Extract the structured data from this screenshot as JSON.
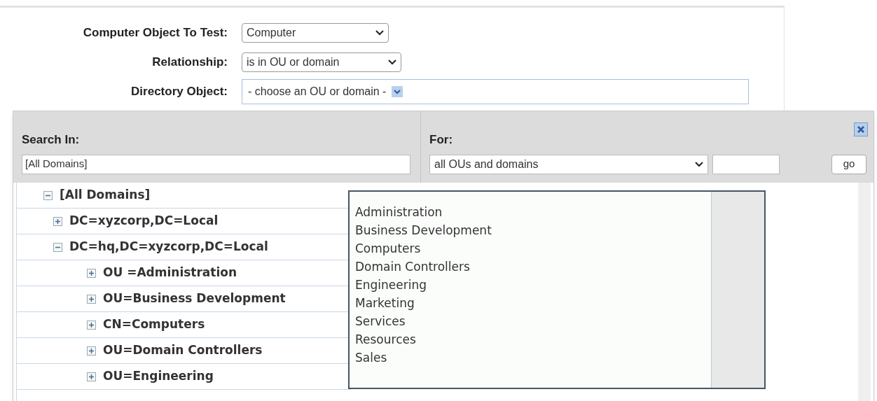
{
  "form": {
    "fields": [
      {
        "label": "Computer Object To Test:",
        "value": "Computer",
        "kind": "select"
      },
      {
        "label": "Relationship:",
        "value": "is in OU or domain",
        "kind": "select"
      },
      {
        "label": "Directory Object:",
        "value": "- choose an OU or domain -",
        "kind": "picker"
      }
    ]
  },
  "picker": {
    "search_in": {
      "label": "Search In:",
      "value": "[All Domains]"
    },
    "for": {
      "label": "For:",
      "value": "all OUs and domains"
    },
    "go_button": "go",
    "tree": [
      {
        "label": "[All Domains]",
        "expanded": true,
        "children": [
          {
            "label": "DC=xyzcorp,DC=Local",
            "expanded": false
          },
          {
            "label": "DC=hq,DC=xyzcorp,DC=Local",
            "expanded": true,
            "children": [
              {
                "label": "OU =Administration",
                "expanded": false
              },
              {
                "label": "OU=Business Development",
                "expanded": false
              },
              {
                "label": "CN=Computers",
                "expanded": false
              },
              {
                "label": "OU=Domain Controllers",
                "expanded": false
              },
              {
                "label": "OU=Engineering",
                "expanded": false
              }
            ]
          }
        ]
      }
    ],
    "dropdown": [
      "Administration",
      "Business Development",
      "Computers",
      "Domain Controllers",
      "Engineering",
      "Marketing",
      "Services",
      "Resources",
      "Sales"
    ]
  }
}
